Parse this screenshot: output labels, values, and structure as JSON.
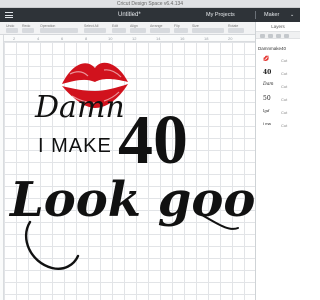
{
  "window": {
    "title": "Cricut Design Space  v6.4.134"
  },
  "topbar": {
    "document_title": "Untitled*",
    "my_projects": "My Projects",
    "machine": "Maker",
    "chevron": "⌄"
  },
  "toolbar": {
    "labels": [
      "Undo",
      "Redo",
      "Operation",
      "Select All",
      "Edit",
      "Align",
      "Arrange",
      "Flip",
      "Size",
      "Rotate"
    ]
  },
  "ruler": {
    "ticks": [
      "2",
      "4",
      "6",
      "8",
      "10",
      "12",
      "14",
      "16",
      "18",
      "20"
    ]
  },
  "design": {
    "line1": "Damn",
    "line2": "I MAKE",
    "number": "40",
    "line3": "Look good",
    "lips_color": "#d1121d"
  },
  "layers": {
    "title": "Layers",
    "group_name": "Damnmake40",
    "items": [
      {
        "thumb": "💋",
        "label": "Cut"
      },
      {
        "thumb": "40",
        "label": "Cut"
      },
      {
        "thumb": "Dam",
        "label": "Cut"
      },
      {
        "thumb": "50",
        "label": "Cut"
      },
      {
        "thumb": "lgd",
        "label": "Cut"
      },
      {
        "thumb": "I ma",
        "label": "Cut"
      }
    ]
  }
}
